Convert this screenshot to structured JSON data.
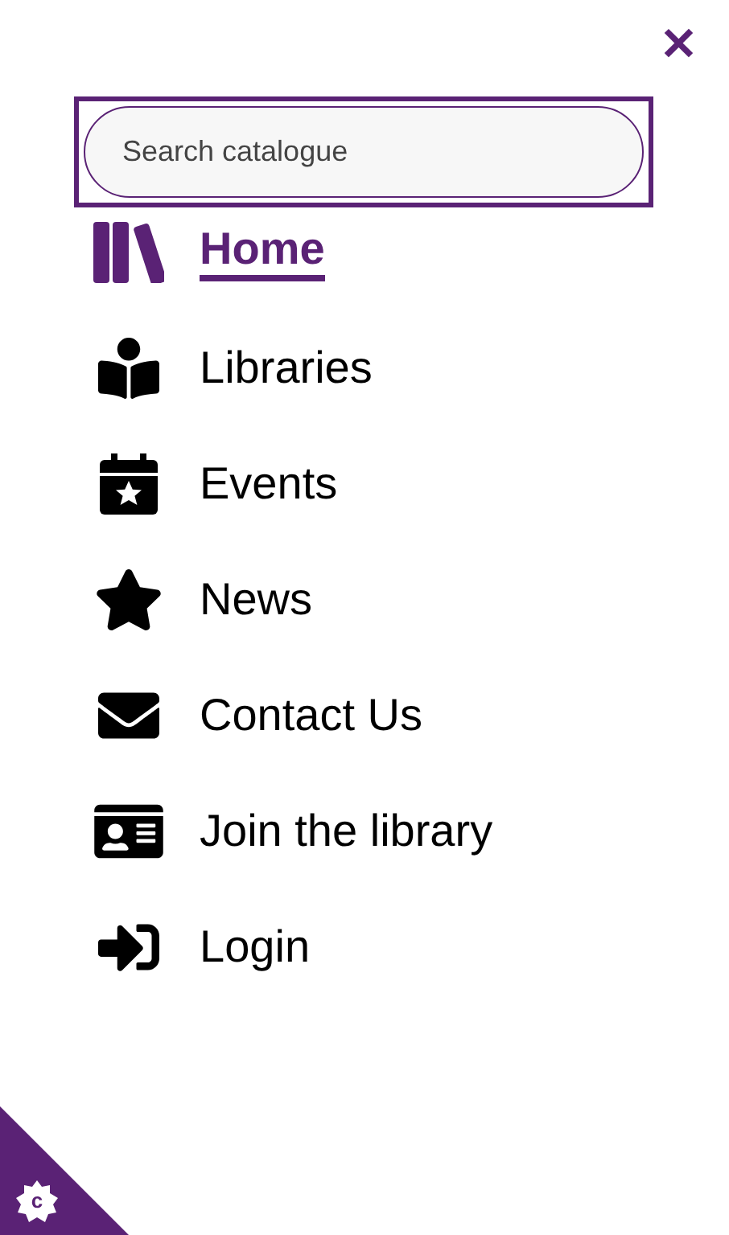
{
  "close_button": {
    "label": "✕"
  },
  "search": {
    "placeholder": "Search catalogue"
  },
  "menu": [
    {
      "label": "Home",
      "selected": true
    },
    {
      "label": "Libraries",
      "selected": false
    },
    {
      "label": "Events",
      "selected": false
    },
    {
      "label": "News",
      "selected": false
    },
    {
      "label": "Contact Us",
      "selected": false
    },
    {
      "label": "Join the library",
      "selected": false
    },
    {
      "label": "Login",
      "selected": false
    }
  ],
  "corner_badge": {
    "label": "c"
  }
}
